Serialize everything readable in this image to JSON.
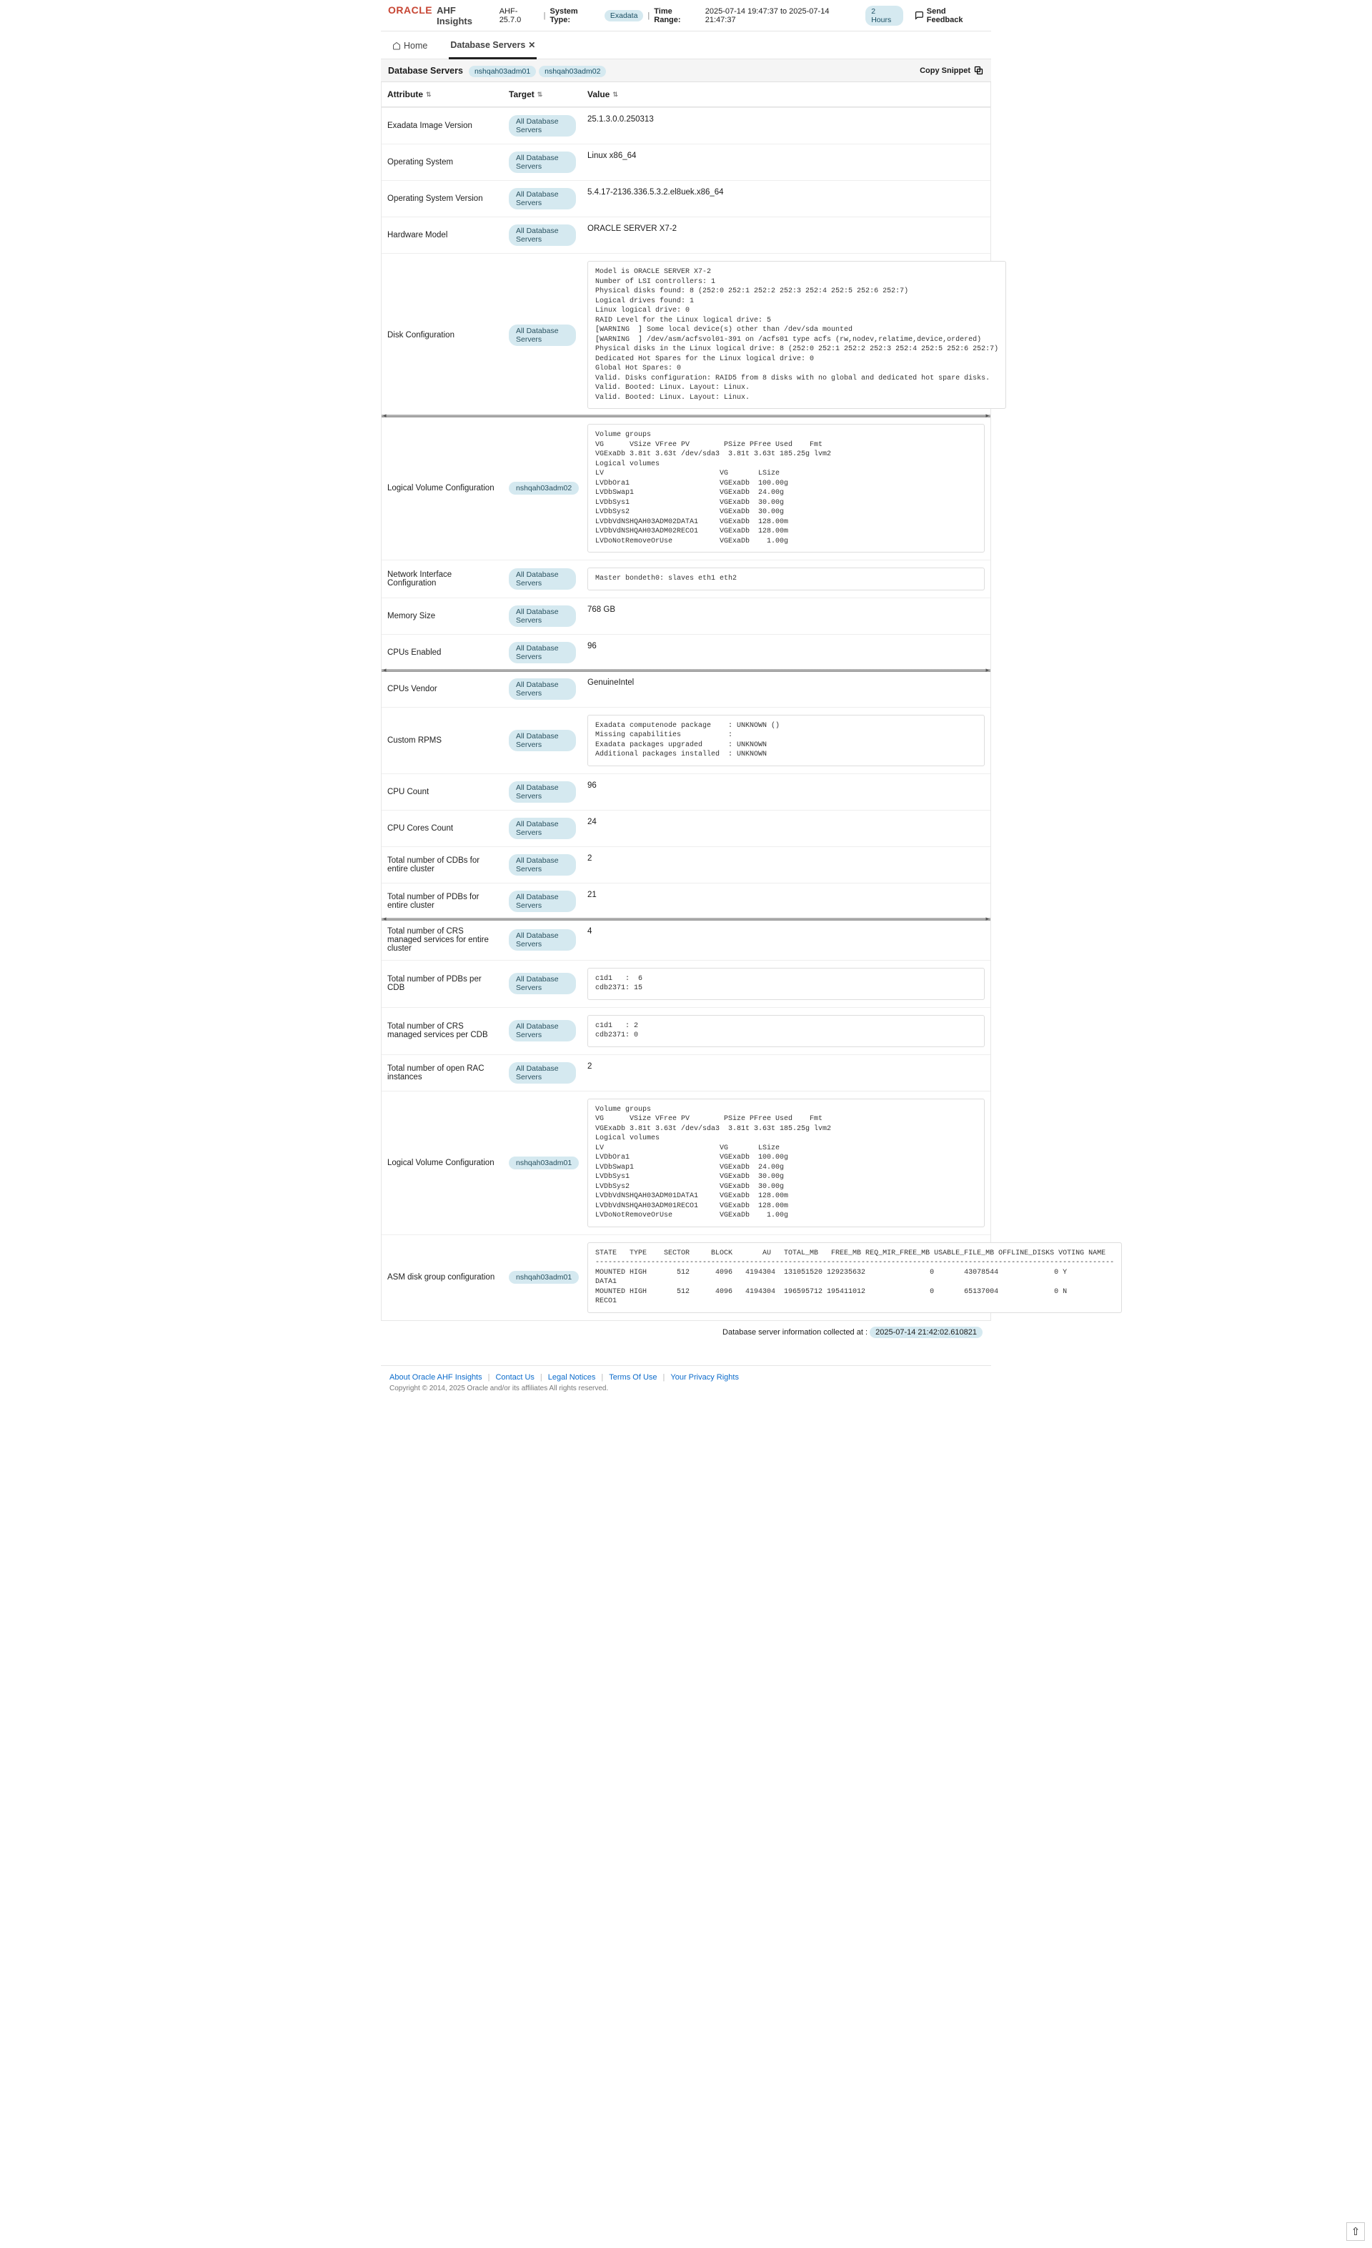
{
  "header": {
    "brand_primary": "ORACLE",
    "brand_secondary": "AHF Insights",
    "version": "AHF-25.7.0",
    "system_type_label": "System Type:",
    "system_type_value": "Exadata",
    "time_range_label": "Time Range:",
    "time_range_value": "2025-07-14 19:47:37 to 2025-07-14 21:47:37",
    "time_range_duration": "2 Hours",
    "feedback_label": "Send Feedback"
  },
  "tabs": {
    "home": "Home",
    "db_servers": "Database Servers"
  },
  "filterbar": {
    "title": "Database Servers",
    "chips": [
      "nshqah03adm01",
      "nshqah03adm02"
    ],
    "copy_label": "Copy Snippet"
  },
  "columns": {
    "attribute": "Attribute",
    "target": "Target",
    "value": "Value"
  },
  "target_all": "All Database Servers",
  "rows": [
    {
      "attribute": "Exadata Image Version",
      "target": "all",
      "value_type": "text",
      "value": "25.1.3.0.0.250313"
    },
    {
      "attribute": "Operating System",
      "target": "all",
      "value_type": "text",
      "value": "Linux x86_64"
    },
    {
      "attribute": "Operating System Version",
      "target": "all",
      "value_type": "text",
      "value": "5.4.17-2136.336.5.3.2.el8uek.x86_64"
    },
    {
      "attribute": "Hardware Model",
      "target": "all",
      "value_type": "text",
      "value": "ORACLE SERVER X7-2"
    },
    {
      "attribute": "Disk Configuration",
      "target": "all",
      "value_type": "pre",
      "value": "Model is ORACLE SERVER X7-2\nNumber of LSI controllers: 1\nPhysical disks found: 8 (252:0 252:1 252:2 252:3 252:4 252:5 252:6 252:7)\nLogical drives found: 1\nLinux logical drive: 0\nRAID Level for the Linux logical drive: 5\n[WARNING  ] Some local device(s) other than /dev/sda mounted\n[WARNING  ] /dev/asm/acfsvol01-391 on /acfs01 type acfs (rw,nodev,relatime,device,ordered)\nPhysical disks in the Linux logical drive: 8 (252:0 252:1 252:2 252:3 252:4 252:5 252:6 252:7)\nDedicated Hot Spares for the Linux logical drive: 0\nGlobal Hot Spares: 0\nValid. Disks configuration: RAID5 from 8 disks with no global and dedicated hot spare disks.\nValid. Booted: Linux. Layout: Linux.\nValid. Booted: Linux. Layout: Linux."
    },
    {
      "attribute": "Logical Volume Configuration",
      "target": "nshqah03adm02",
      "value_type": "pre",
      "value": "Volume groups\nVG      VSize VFree PV        PSize PFree Used    Fmt\nVGExaDb 3.81t 3.63t /dev/sda3  3.81t 3.63t 185.25g lvm2\nLogical volumes\nLV                           VG       LSize\nLVDbOra1                     VGExaDb  100.00g\nLVDbSwap1                    VGExaDb  24.00g\nLVDbSys1                     VGExaDb  30.00g\nLVDbSys2                     VGExaDb  30.00g\nLVDbVdNSHQAH03ADM02DATA1     VGExaDb  128.00m\nLVDbVdNSHQAH03ADM02RECO1     VGExaDb  128.00m\nLVDoNotRemoveOrUse           VGExaDb    1.00g"
    },
    {
      "attribute": "Network Interface Configuration",
      "target": "all",
      "value_type": "pre",
      "value": "Master bondeth0: slaves eth1 eth2"
    },
    {
      "attribute": "Memory Size",
      "target": "all",
      "value_type": "text",
      "value": "768 GB"
    },
    {
      "attribute": "CPUs Enabled",
      "target": "all",
      "value_type": "text",
      "value": "96"
    },
    {
      "attribute": "CPUs Vendor",
      "target": "all",
      "value_type": "text",
      "value": "GenuineIntel"
    },
    {
      "attribute": "Custom RPMS",
      "target": "all",
      "value_type": "pre",
      "value": "Exadata computenode package    : UNKNOWN ()\nMissing capabilities           :\nExadata packages upgraded      : UNKNOWN\nAdditional packages installed  : UNKNOWN"
    },
    {
      "attribute": "CPU Count",
      "target": "all",
      "value_type": "text",
      "value": "96"
    },
    {
      "attribute": "CPU Cores Count",
      "target": "all",
      "value_type": "text",
      "value": "24"
    },
    {
      "attribute": "Total number of CDBs for entire cluster",
      "target": "all",
      "value_type": "text",
      "value": "2"
    },
    {
      "attribute": "Total number of PDBs for entire cluster",
      "target": "all",
      "value_type": "text",
      "value": "21"
    },
    {
      "attribute": "Total number of CRS managed services for entire cluster",
      "target": "all",
      "value_type": "text",
      "value": "4"
    },
    {
      "attribute": "Total number of PDBs per CDB",
      "target": "all",
      "value_type": "pre",
      "value": "c1d1   :  6\ncdb2371: 15"
    },
    {
      "attribute": "Total number of CRS managed services per CDB",
      "target": "all",
      "value_type": "pre",
      "value": "c1d1   : 2\ncdb2371: 0"
    },
    {
      "attribute": "Total number of open RAC instances",
      "target": "all",
      "value_type": "text",
      "value": "2"
    },
    {
      "attribute": "Logical Volume Configuration",
      "target": "nshqah03adm01",
      "value_type": "pre",
      "value": "Volume groups\nVG      VSize VFree PV        PSize PFree Used    Fmt\nVGExaDb 3.81t 3.63t /dev/sda3  3.81t 3.63t 185.25g lvm2\nLogical volumes\nLV                           VG       LSize\nLVDbOra1                     VGExaDb  100.00g\nLVDbSwap1                    VGExaDb  24.00g\nLVDbSys1                     VGExaDb  30.00g\nLVDbSys2                     VGExaDb  30.00g\nLVDbVdNSHQAH03ADM01DATA1     VGExaDb  128.00m\nLVDbVdNSHQAH03ADM01RECO1     VGExaDb  128.00m\nLVDoNotRemoveOrUse           VGExaDb    1.00g"
    },
    {
      "attribute": "ASM disk group configuration",
      "target": "nshqah03adm01",
      "value_type": "pre",
      "value": "STATE   TYPE    SECTOR     BLOCK       AU   TOTAL_MB   FREE_MB REQ_MIR_FREE_MB USABLE_FILE_MB OFFLINE_DISKS VOTING NAME\n-------------------------------------------------------------------------------------------------------------------------\nMOUNTED HIGH       512      4096   4194304  131051520 129235632               0       43078544             0 Y\nDATA1\nMOUNTED HIGH       512      4096   4194304  196595712 195411012               0       65137004             0 N\nRECO1"
    }
  ],
  "splitters_after_row_index": [
    4,
    8,
    14
  ],
  "collected": {
    "label": "Database server information collected at :",
    "timestamp": "2025-07-14 21:42:02.610821"
  },
  "footer": {
    "links": [
      "About Oracle AHF Insights",
      "Contact Us",
      "Legal Notices",
      "Terms Of Use",
      "Your Privacy Rights"
    ],
    "copyright": "Copyright © 2014, 2025 Oracle and/or its affiliates All rights reserved."
  }
}
